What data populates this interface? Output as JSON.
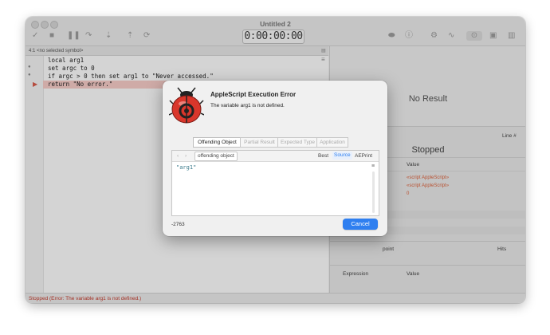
{
  "window": {
    "title": "Untitled 2",
    "timer": "0:00:00:00"
  },
  "symbol_bar": {
    "location": "4:1",
    "symbol": "<no selected symbol>"
  },
  "code": {
    "lines": [
      "local arg1",
      "set argc to 0",
      "if argc > 0 then set arg1 to \"Never accessed.\"",
      "return \"No error.\""
    ]
  },
  "right_pane": {
    "result_title": "No Result",
    "line_header": "Line #",
    "stopped_title": "Stopped",
    "value_header": "Value",
    "values": [
      "«script AppleScript»",
      "«script AppleScript»",
      "0"
    ],
    "breakpoint_header": "point",
    "hits_header": "Hits",
    "expression_header": "Expression",
    "expression_value_header": "Value",
    "add_label": "+",
    "remove_label": "−",
    "refresh_label": "↻"
  },
  "status": {
    "message": "Stopped (Error: The variable arg1 is not defined.)"
  },
  "dialog": {
    "title": "AppleScript Execution Error",
    "message": "The variable arg1 is not defined.",
    "tabs": [
      "Offending Object",
      "Partial Result",
      "Expected Type",
      "Application"
    ],
    "selected_tab": "Offending Object",
    "nav_back": "‹",
    "nav_forward": "›",
    "path_label": "offending object",
    "view_modes": [
      "Best",
      "Source",
      "AEPrint"
    ],
    "selected_view_mode": "Source",
    "content": "\"arg1\"",
    "error_code": "-2763",
    "cancel_button": "Cancel"
  },
  "colors": {
    "accent": "#2f7ff0",
    "error_text": "#c0392b",
    "code_variable": "#4a8a2a",
    "line_highlight": "#f4c9c5"
  }
}
